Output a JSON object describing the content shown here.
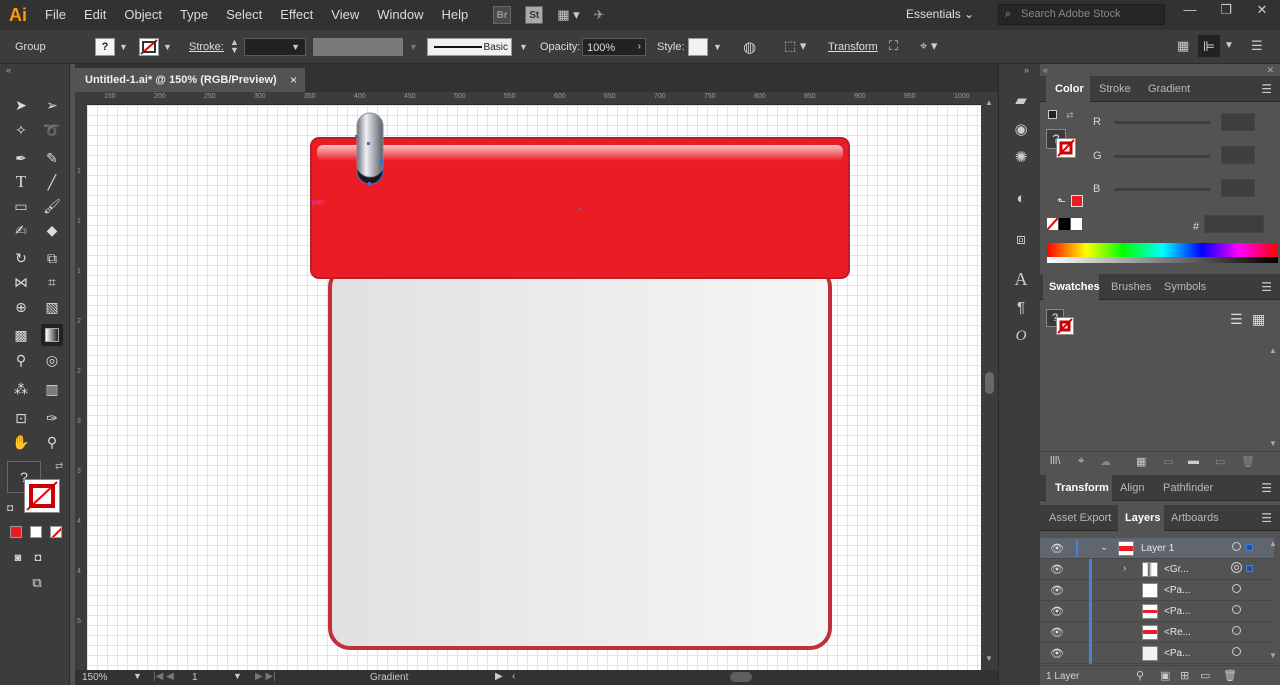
{
  "app": {
    "logo": "Ai"
  },
  "menu": [
    "File",
    "Edit",
    "Object",
    "Type",
    "Select",
    "Effect",
    "View",
    "Window",
    "Help"
  ],
  "menu_icons": {
    "bridge": "Br",
    "stock": "St"
  },
  "workspace": "Essentials",
  "search": {
    "placeholder": "Search Adobe Stock"
  },
  "control_bar": {
    "selection": "Group",
    "fill_label": "?",
    "stroke_label": "Stroke:",
    "brush_label": "Basic",
    "opacity_label": "Opacity:",
    "opacity_value": "100%",
    "style_label": "Style:",
    "transform_label": "Transform"
  },
  "document": {
    "tab_title": "Untitled-1.ai* @ 150% (RGB/Preview)",
    "close_glyph": "×",
    "path_hint": "path"
  },
  "ruler": {
    "h_ticks": [
      "150",
      "200",
      "250",
      "300",
      "350",
      "400",
      "450",
      "500",
      "550",
      "600",
      "650",
      "700",
      "750",
      "800",
      "850",
      "900",
      "950",
      "1000"
    ],
    "v_ticks": [
      "1",
      "1",
      "1",
      "2",
      "2",
      "2",
      "2",
      "2",
      "3",
      "3",
      "3",
      "3",
      "4",
      "4",
      "4",
      "4",
      "5",
      "5",
      "5",
      "5",
      "6",
      "6",
      "6",
      "6"
    ]
  },
  "status": {
    "zoom": "150%",
    "artboard": "1",
    "tool": "Gradient"
  },
  "color_panel": {
    "tabs": [
      "Color",
      "Stroke",
      "Gradient"
    ],
    "channels": [
      "R",
      "G",
      "B"
    ],
    "hex_symbol": "#",
    "fill_glyph": "?"
  },
  "swatches_panel": {
    "tabs": [
      "Swatches",
      "Brushes",
      "Symbols"
    ],
    "fill_glyph": "?"
  },
  "transform_panel": {
    "tabs": [
      "Transform",
      "Align",
      "Pathfinder"
    ]
  },
  "layers_panel": {
    "tabs": [
      "Asset Export",
      "Layers",
      "Artboards"
    ],
    "rows": [
      {
        "name": "Layer 1"
      },
      {
        "name": "<Gr..."
      },
      {
        "name": "<Pa..."
      },
      {
        "name": "<Pa..."
      },
      {
        "name": "<Re..."
      },
      {
        "name": "<Pa..."
      }
    ],
    "footer": "1 Layer"
  },
  "colors": {
    "accent_red": "#ec1c24",
    "panel_bg": "#535353",
    "ui_dark": "#323232",
    "selection_blue": "#4a7fd8",
    "ai_orange": "#ff9a00"
  }
}
